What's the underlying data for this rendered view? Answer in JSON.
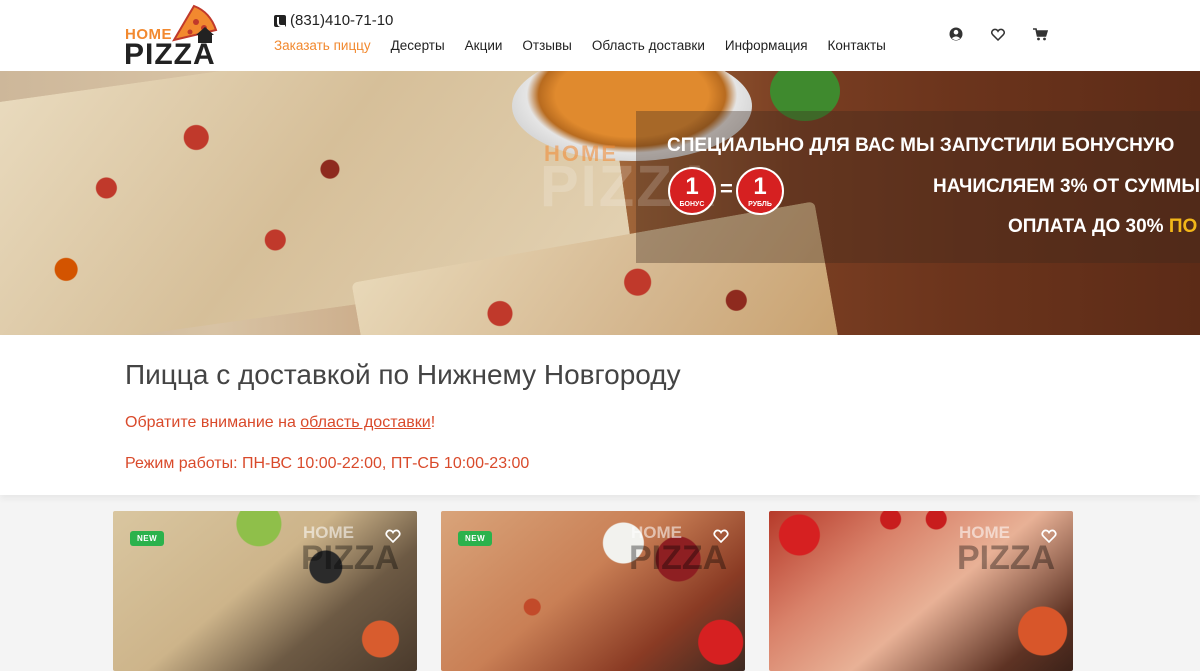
{
  "header": {
    "logo": {
      "top": "HOME",
      "bottom": "PIZZA"
    },
    "phone": "(831)410-71-10",
    "nav": [
      {
        "label": "Заказать пиццу",
        "active": true
      },
      {
        "label": "Десерты",
        "active": false
      },
      {
        "label": "Акции",
        "active": false
      },
      {
        "label": "Отзывы",
        "active": false
      },
      {
        "label": "Область доставки",
        "active": false
      },
      {
        "label": "Информация",
        "active": false
      },
      {
        "label": "Контакты",
        "active": false
      }
    ],
    "icons": [
      "user-icon",
      "heart-icon",
      "cart-icon"
    ]
  },
  "banner": {
    "watermark_top": "HOME",
    "watermark_bottom": "PIZZA",
    "line1": "СПЕЦИАЛЬНО ДЛЯ ВАС МЫ ЗАПУСТИЛИ БОНУСНУЮ",
    "line2": "НАЧИСЛЯЕМ 3% ОТ СУММЫ",
    "line3_main": "ОПЛАТА ДО 30% ",
    "line3_accent": "ПО",
    "coin_left": {
      "value": "1",
      "label": "БОНУС"
    },
    "coin_equals": "=",
    "coin_right": {
      "value": "1",
      "label": "РУБЛЬ"
    }
  },
  "intro": {
    "title": "Пицца с доставкой по Нижнему Новгороду",
    "note_prefix": "Обратите внимание на ",
    "note_link": "область доставки",
    "note_suffix": "!",
    "hours": "Режим работы: ПН-ВС 10:00-22:00, ПТ-СБ 10:00-23:00"
  },
  "products": [
    {
      "badge": "NEW",
      "watermark_top": "HOME",
      "watermark_bottom": "PIZZA"
    },
    {
      "badge": "NEW",
      "watermark_top": "HOME",
      "watermark_bottom": "PIZZA"
    },
    {
      "badge": "",
      "watermark_top": "HOME",
      "watermark_bottom": "PIZZA"
    }
  ],
  "colors": {
    "accent": "#f2892f",
    "note_red": "#d94a2b",
    "badge_green": "#2bb24c",
    "coin_red": "#d62021",
    "banner_yellow": "#f2b619"
  }
}
